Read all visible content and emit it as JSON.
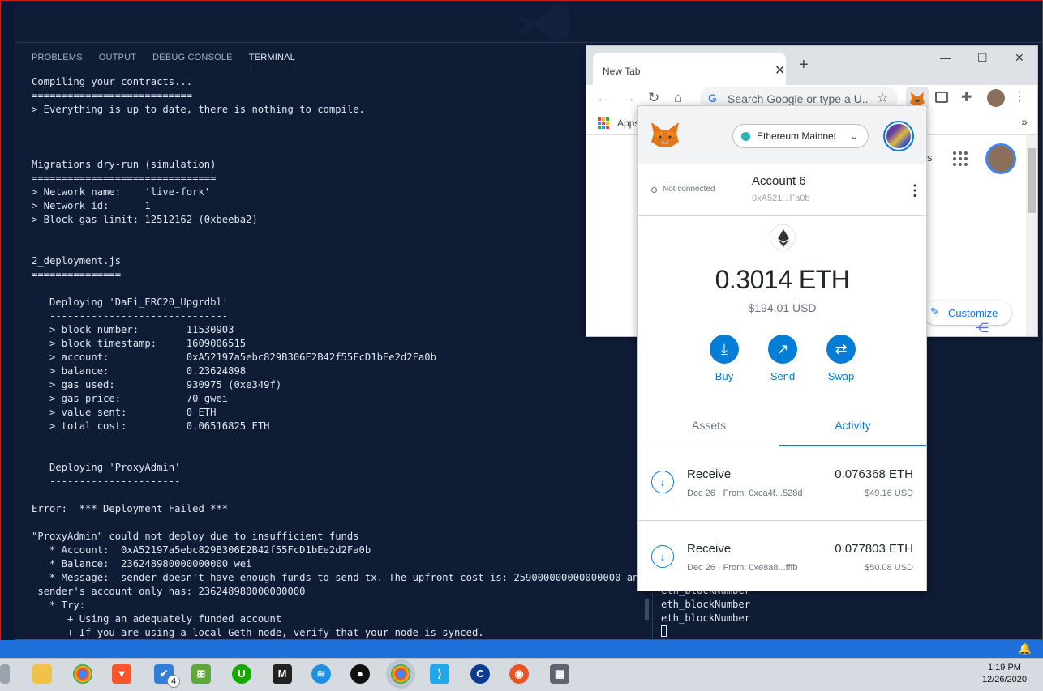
{
  "vscode": {
    "panel_tabs": [
      "PROBLEMS",
      "OUTPUT",
      "DEBUG CONSOLE",
      "TERMINAL"
    ],
    "terminal_lines": [
      "Compiling your contracts...",
      "===========================",
      "> Everything is up to date, there is nothing to compile.",
      "",
      "",
      "",
      "Migrations dry-run (simulation)",
      "===============================",
      "> Network name:    'live-fork'",
      "> Network id:      1",
      "> Block gas limit: 12512162 (0xbeeba2)",
      "",
      "",
      "2_deployment.js",
      "===============",
      "",
      "   Deploying 'DaFi_ERC20_Upgrdbl'",
      "   ------------------------------",
      "   > block number:        11530903",
      "   > block timestamp:     1609006515",
      "   > account:             0xA52197a5ebc829B306E2B42f55FcD1bEe2d2Fa0b",
      "   > balance:             0.23624898",
      "   > gas used:            930975 (0xe349f)",
      "   > gas price:           70 gwei",
      "   > value sent:          0 ETH",
      "   > total cost:          0.06516825 ETH",
      "",
      "",
      "   Deploying 'ProxyAdmin'",
      "   ----------------------",
      "",
      "Error:  *** Deployment Failed ***",
      "",
      "\"ProxyAdmin\" could not deploy due to insufficient funds",
      "   * Account:  0xA52197a5ebc829B306E2B42f55FcD1bEe2d2Fa0b",
      "   * Balance:  236248980000000000 wei",
      "   * Message:  sender doesn't have enough funds to send tx. The upfront cost is: 259000000000000000 and the",
      " sender's account only has: 236248980000000000",
      "   * Try:",
      "      + Using an adequately funded account",
      "      + If you are using a local Geth node, verify that your node is synced."
    ],
    "terminal2_lines": [
      "eth_blockNumber",
      "eth_blockNumber",
      "eth_blockNumber"
    ]
  },
  "chrome": {
    "tab_title": "New Tab",
    "omnibox_placeholder": "Search Google or type a U...",
    "bookmarks_apps": "Apps",
    "customize_label": "Customize",
    "ntp_partial": "s"
  },
  "metamask": {
    "network": "Ethereum Mainnet",
    "connection_status": "Not connected",
    "account_name": "Account 6",
    "account_address": "0xA521...Fa0b",
    "balance": "0.3014 ETH",
    "balance_usd": "$194.01 USD",
    "actions": [
      {
        "label": "Buy",
        "icon": "download-icon"
      },
      {
        "label": "Send",
        "icon": "arrow-up-right-icon"
      },
      {
        "label": "Swap",
        "icon": "swap-icon"
      }
    ],
    "tabs": {
      "assets": "Assets",
      "activity": "Activity",
      "active": "Activity"
    },
    "transactions": [
      {
        "title": "Receive",
        "subtitle": "Dec 26 · From: 0xca4f...528d",
        "amount": "0.076368 ETH",
        "usd": "$49.16 USD"
      },
      {
        "title": "Receive",
        "subtitle": "Dec 26 · From: 0xe8a8...fffb",
        "amount": "0.077803 ETH",
        "usd": "$50.08 USD"
      }
    ],
    "accent_color": "#037dd6"
  },
  "taskbar": {
    "time": "1:19 PM",
    "date": "12/26/2020",
    "docker_badge": "4",
    "apps": [
      "file-explorer",
      "chrome",
      "brave",
      "vscode-tasks",
      "windows-store",
      "upwork",
      "medium",
      "docker",
      "github",
      "chrome-active",
      "vscode",
      "codepen",
      "ubuntu",
      "calculator"
    ]
  }
}
